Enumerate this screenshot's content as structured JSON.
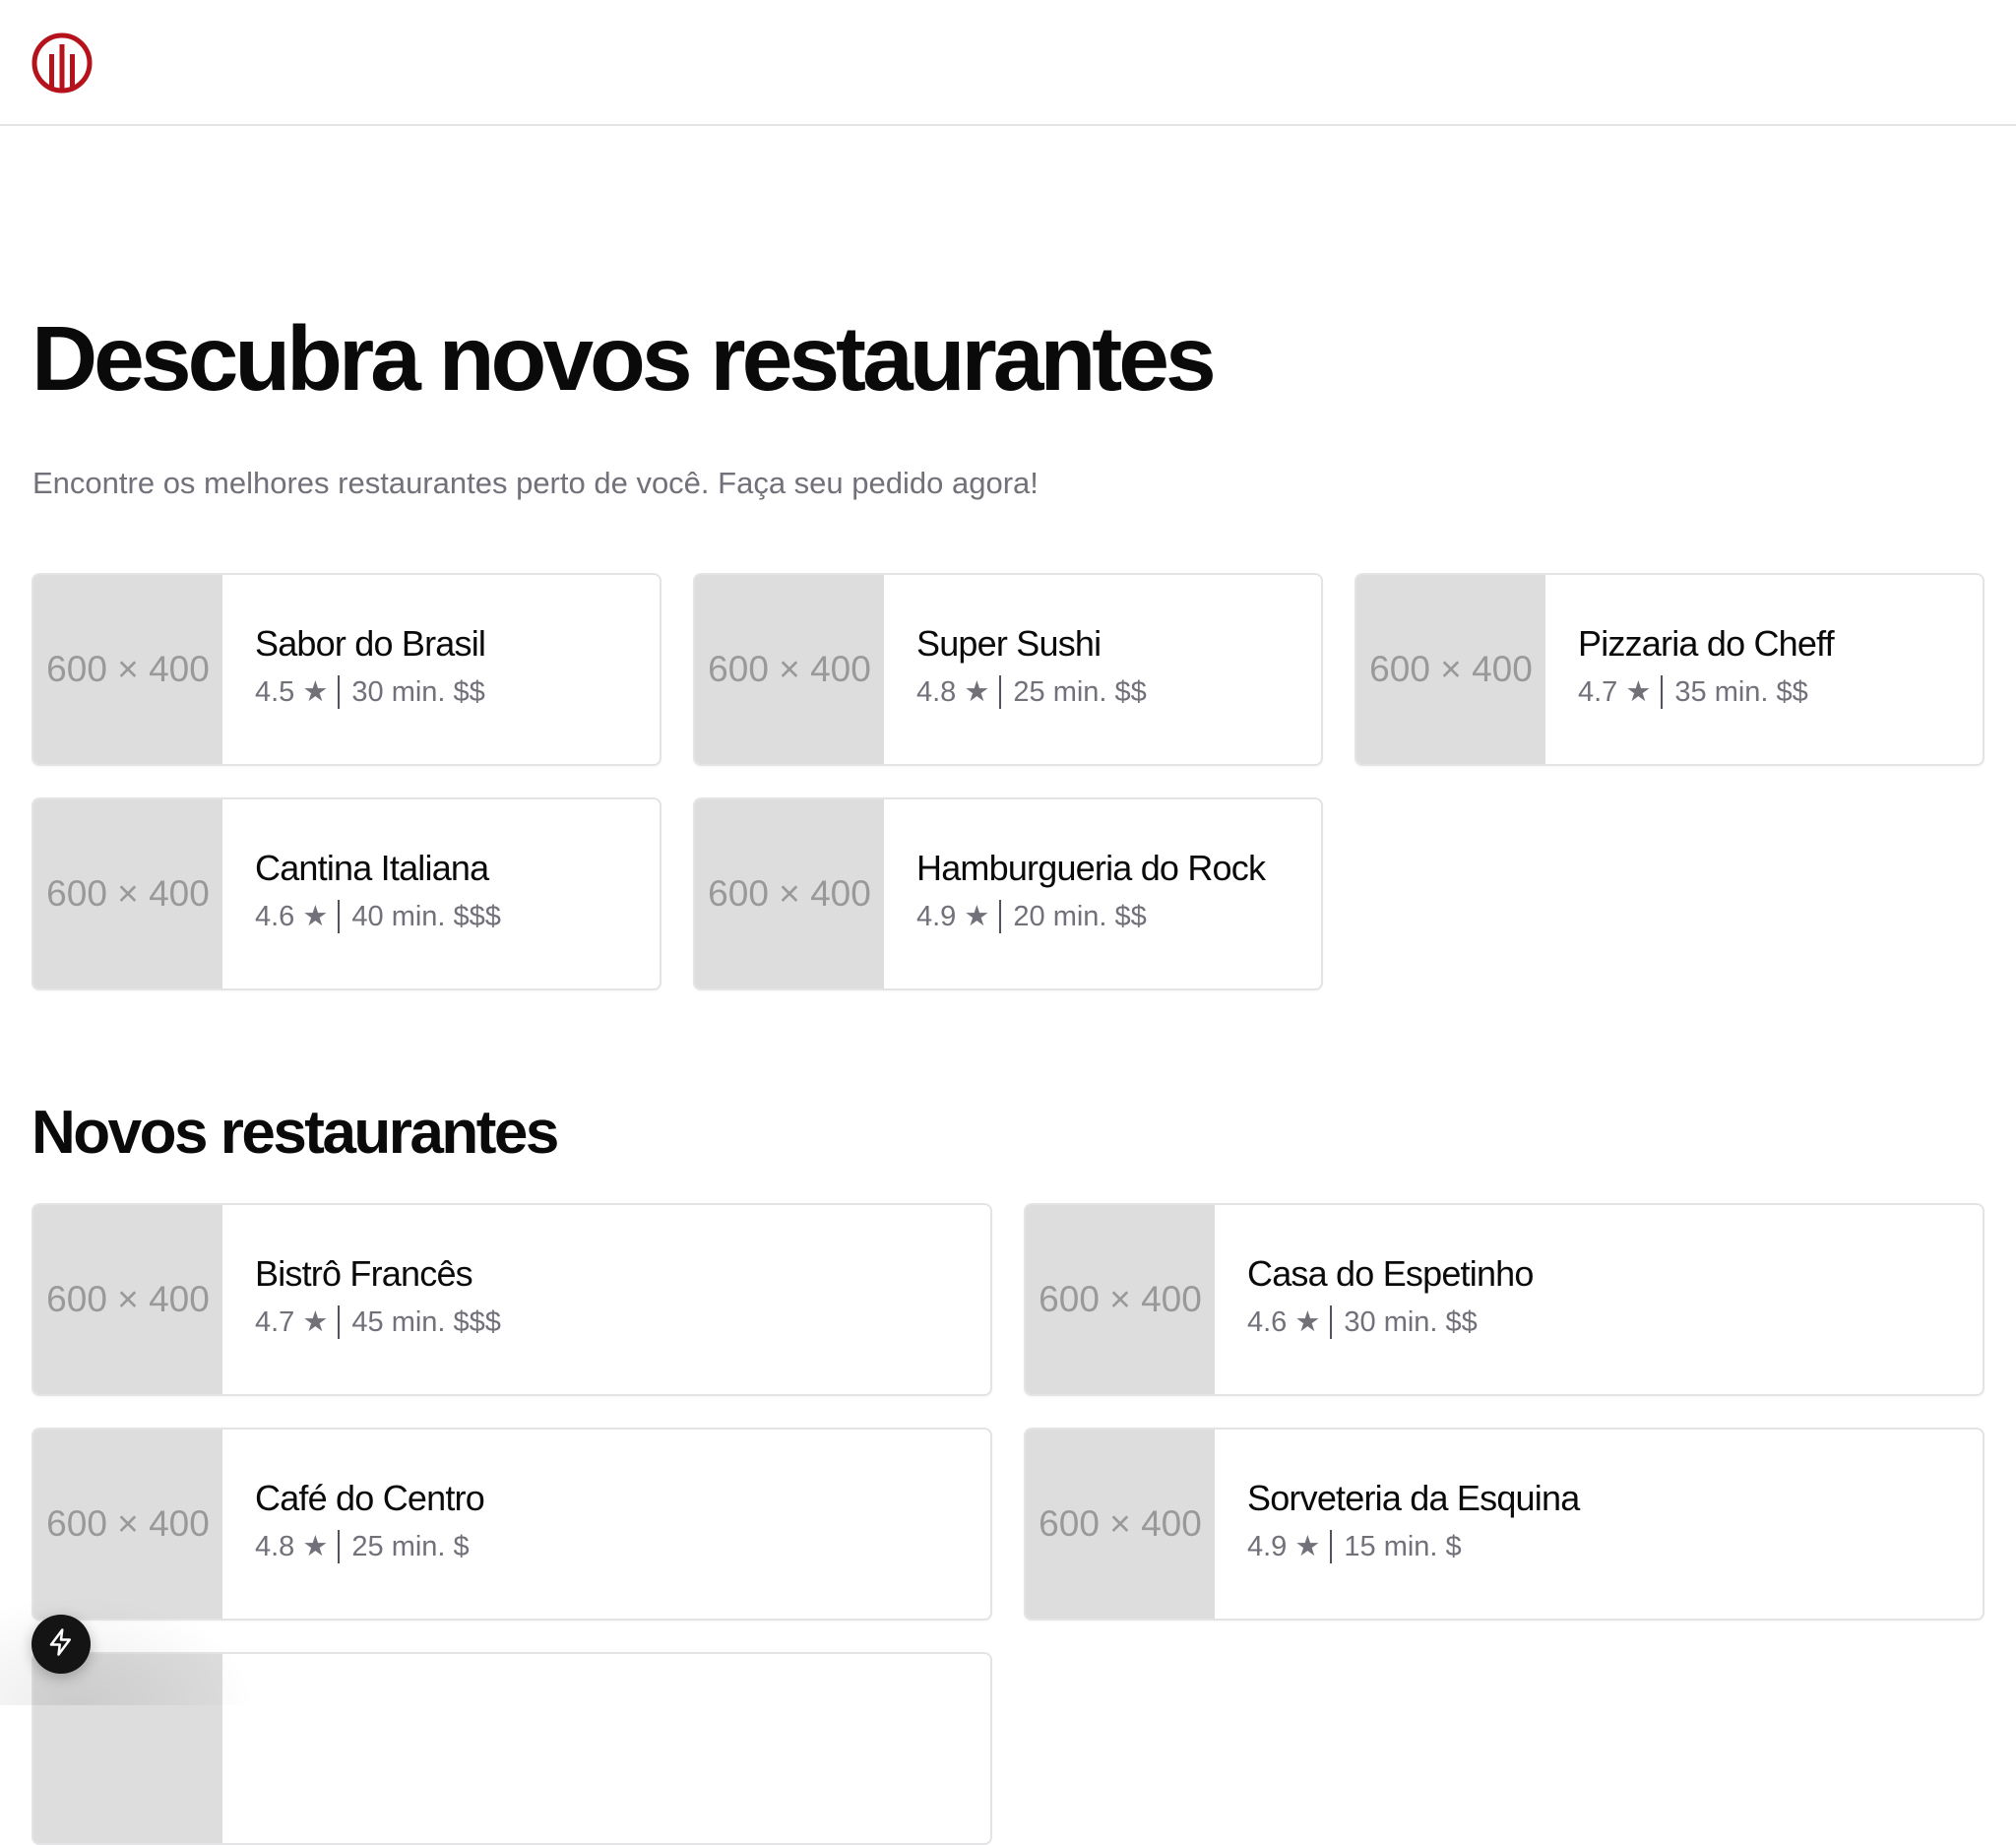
{
  "header": {
    "logo_icon": "restaurant-logo-icon",
    "brand_color": "#b5121b"
  },
  "hero": {
    "title": "Descubra novos restaurantes",
    "subtitle": "Encontre os melhores restaurantes perto de você. Faça seu pedido agora!"
  },
  "featured": [
    {
      "image": "600 × 400",
      "name": "Sabor do Brasil",
      "rating": "4.5 ★",
      "details": "30 min. $$"
    },
    {
      "image": "600 × 400",
      "name": "Super Sushi",
      "rating": "4.8 ★",
      "details": "25 min. $$"
    },
    {
      "image": "600 × 400",
      "name": "Pizzaria do Cheff",
      "rating": "4.7 ★",
      "details": "35 min. $$"
    },
    {
      "image": "600 × 400",
      "name": "Cantina Italiana",
      "rating": "4.6 ★",
      "details": "40 min. $$$"
    },
    {
      "image": "600 × 400",
      "name": "Hamburgueria do Rock",
      "rating": "4.9 ★",
      "details": "20 min. $$"
    }
  ],
  "new_section": {
    "title": "Novos restaurantes",
    "items": [
      {
        "image": "600 × 400",
        "name": "Bistrô Francês",
        "rating": "4.7 ★",
        "details": "45 min. $$$"
      },
      {
        "image": "600 × 400",
        "name": "Casa do Espetinho",
        "rating": "4.6 ★",
        "details": "30 min. $$"
      },
      {
        "image": "600 × 400",
        "name": "Café do Centro",
        "rating": "4.8 ★",
        "details": "25 min. $"
      },
      {
        "image": "600 × 400",
        "name": "Sorveteria da Esquina",
        "rating": "4.9 ★",
        "details": "15 min. $"
      }
    ]
  },
  "floating_button": {
    "icon": "lightning-bolt-icon"
  }
}
